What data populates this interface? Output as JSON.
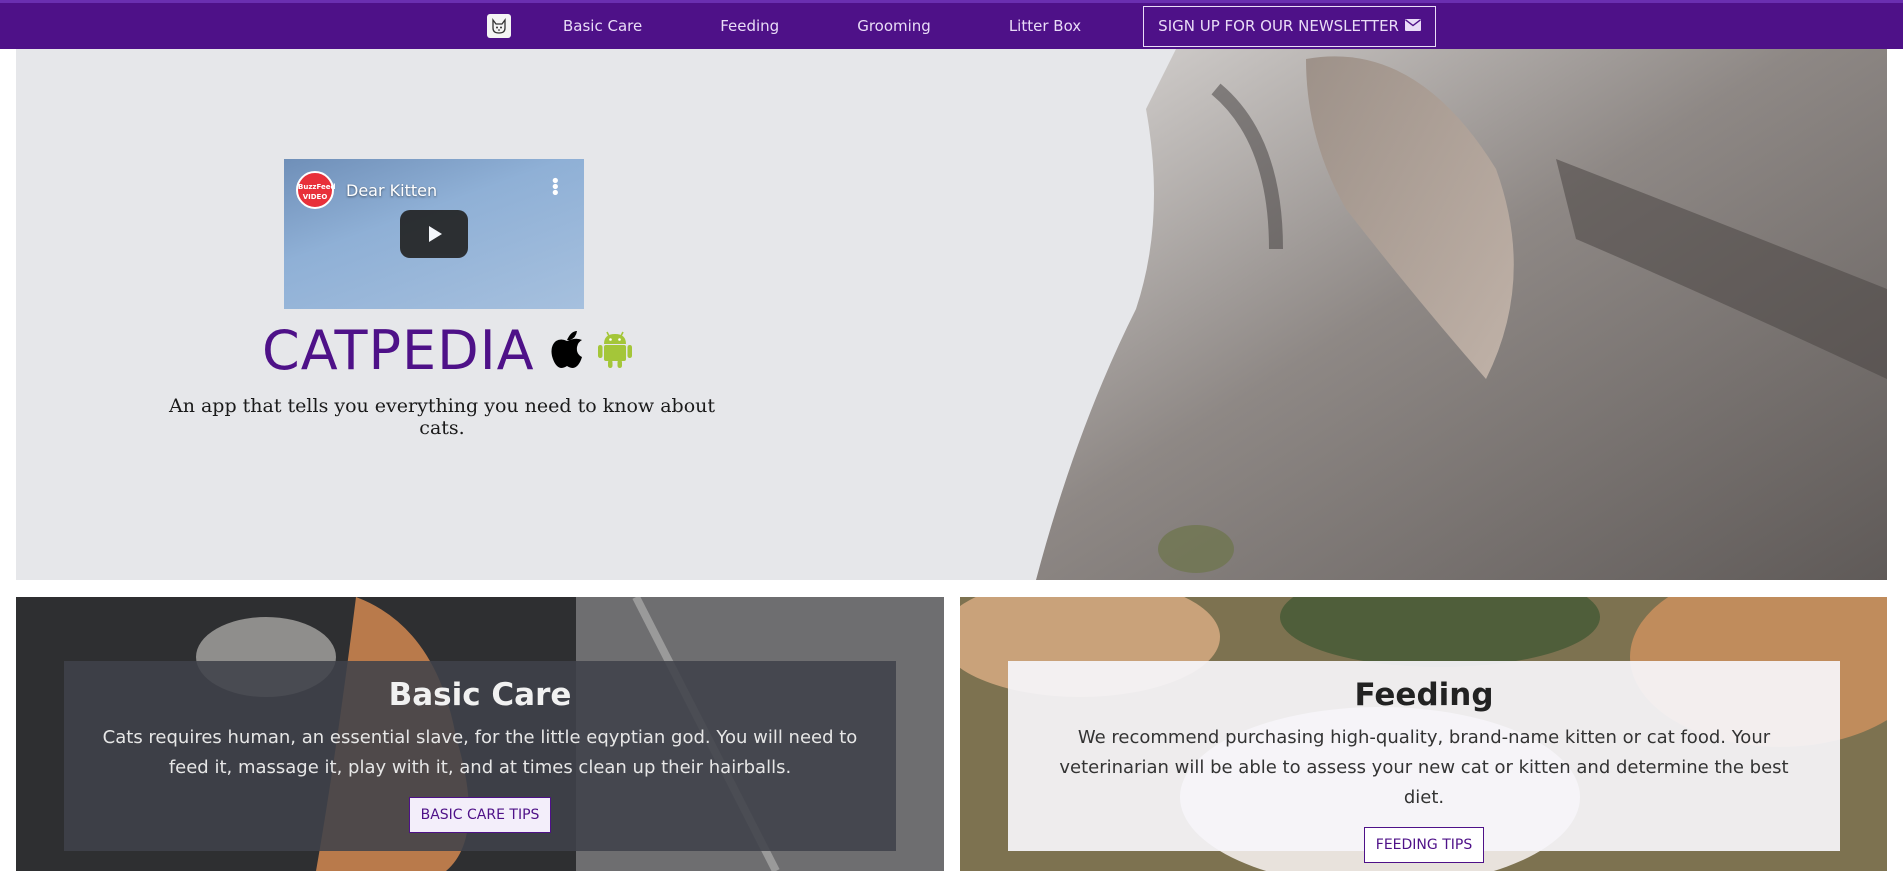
{
  "nav": {
    "brand_icon": "cat-face-icon",
    "links": [
      "Basic Care",
      "Feeding",
      "Grooming",
      "Litter Box"
    ],
    "newsletter_label": "SIGN UP FOR OUR NEWSLETTER",
    "newsletter_icon": "envelope-icon",
    "background": "#4e1188"
  },
  "hero": {
    "video": {
      "channel": "BuzzFeed VIDEO",
      "title": "Dear Kitten",
      "play_icon": "play-icon"
    },
    "title": "CATPEDIA",
    "platform_icons": [
      "apple-icon",
      "android-icon"
    ],
    "tagline": "An app that tells you everything you need to know about cats."
  },
  "cards": [
    {
      "title": "Basic Care",
      "text": "Cats requires human, an essential slave, for the little eqyptian god. You will need to feed it, massage it, play with it, and at times clean up their hairballs.",
      "button": "BASIC CARE TIPS"
    },
    {
      "title": "Feeding",
      "text": "We recommend purchasing high-quality, brand-name kitten or cat food. Your veterinarian will be able to assess your new cat or kitten and determine the best diet.",
      "button": "FEEDING TIPS"
    }
  ],
  "colors": {
    "accent": "#4e1188",
    "android": "#a4c639"
  }
}
